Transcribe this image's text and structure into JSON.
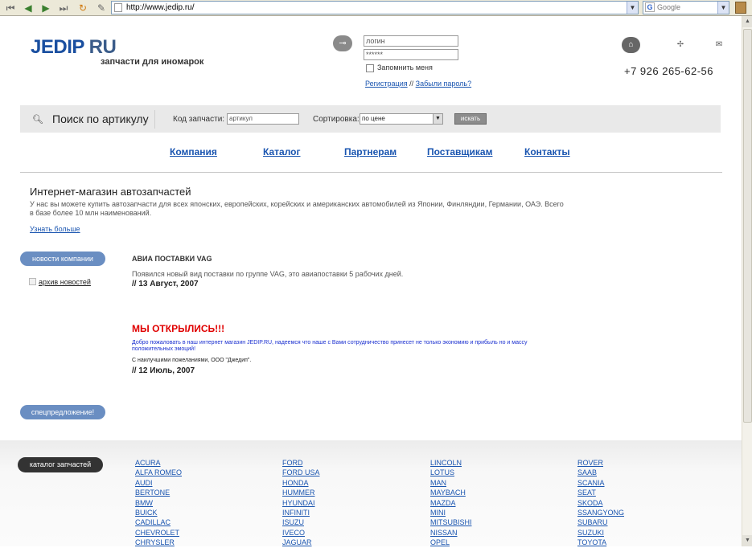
{
  "browser": {
    "url": "http://www.jedip.ru/",
    "search_engine": "Google"
  },
  "header": {
    "logo_main": "JEDIP",
    "logo_suffix": " RU",
    "tagline": "запчасти для иномарок",
    "login_placeholder": "логин",
    "password_value": "******",
    "remember_label": "Запомнить меня",
    "register_link": "Регистрация",
    "links_separator": " // ",
    "forgot_link": "Забыли пароль?",
    "phone": "+7 926 265-62-56"
  },
  "search": {
    "title": "Поиск по артикулу",
    "code_label": "Код запчасти:",
    "code_placeholder": "артикул",
    "sort_label": "Сортировка:",
    "sort_value": "по цене",
    "button": "искать"
  },
  "nav": [
    "Компания",
    "Каталог",
    "Партнерам",
    "Поставщикам",
    "Контакты"
  ],
  "intro": {
    "title": "Интернет-магазин автозапчастей",
    "text": "У нас вы можете купить автозапчасти для всех японских, европейских, корейских и американских автомобилей из Японии, Финляндии, Германии, ОАЭ. Всего в базе более 10 млн наименований.",
    "more": "Узнать больше"
  },
  "sidebar": {
    "news_button": "новости компании",
    "archive_link": "архив новостей",
    "special_button": "спецпредложение!"
  },
  "news": [
    {
      "title": "АВИА ПОСТАВКИ VAG",
      "text": "Появился новый вид поставки по группе VAG, это авиапоставки 5 рабочих дней.",
      "date": "// 13 Август, 2007"
    },
    {
      "title": "МЫ ОТКРЫЛИСЬ!!!",
      "text": "Добро пожаловать в наш интернет магазин JEDIP.RU, надеемся что наше с Вами сотрудничество принесет не только экономию и прибыль но и массу положительных эмоций!",
      "sign": "С наилучшими пожеланиями, ООО \"Джедип\".",
      "date": "// 12 Июль, 2007"
    }
  ],
  "catalog": {
    "button": "каталог запчастей",
    "columns": [
      [
        "ACURA",
        "ALFA ROMEO",
        "AUDI",
        "BERTONE",
        "BMW",
        "BUICK",
        "CADILLAC",
        "CHEVROLET",
        "CHRYSLER"
      ],
      [
        "FORD",
        "FORD USA",
        "HONDA",
        "HUMMER",
        "HYUNDAI",
        "INFINITI",
        "ISUZU",
        "IVECO",
        "JAGUAR"
      ],
      [
        "LINCOLN",
        "LOTUS",
        "MAN",
        "MAYBACH",
        "MAZDA",
        "MINI",
        "MITSUBISHI",
        "NISSAN",
        "OPEL"
      ],
      [
        "ROVER",
        "SAAB",
        "SCANIA",
        "SEAT",
        "SKODA",
        "SSANGYONG",
        "SUBARU",
        "SUZUKI",
        "TOYOTA"
      ]
    ]
  },
  "icons": {
    "key": "key-icon",
    "home": "home-icon",
    "plus": "plus-icon",
    "mail": "mail-icon",
    "search": "search-icon"
  },
  "colors": {
    "brand_blue": "#1a4fa0",
    "link_blue": "#1a55b0",
    "pill_blue": "#6a8ec2",
    "alert_red": "#e00000",
    "dark_pill": "#333333"
  }
}
